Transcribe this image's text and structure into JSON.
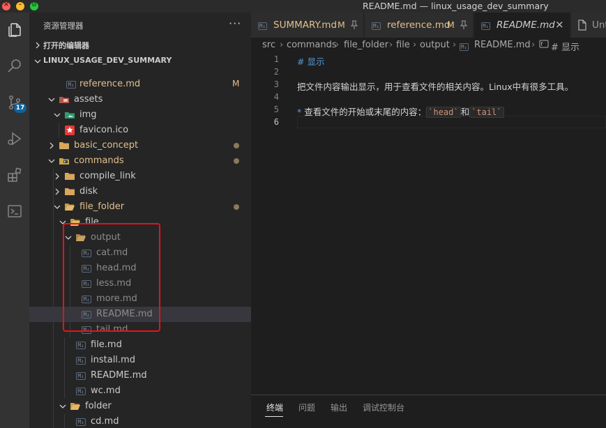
{
  "window": {
    "title": "README.md — linux_usage_dev_summary"
  },
  "activity": {
    "scm_badge": "17"
  },
  "sidebar": {
    "title": "资源管理器",
    "more": "···",
    "open_editors": "打开的编辑器",
    "workspace": "LINUX_USAGE_DEV_SUMMARY"
  },
  "tree": [
    {
      "name": "reference.md",
      "status": "M"
    },
    {
      "name": "assets"
    },
    {
      "name": "img"
    },
    {
      "name": "favicon.ico"
    },
    {
      "name": "basic_concept"
    },
    {
      "name": "commands"
    },
    {
      "name": "compile_link"
    },
    {
      "name": "disk"
    },
    {
      "name": "file_folder"
    },
    {
      "name": "file"
    },
    {
      "name": "output"
    },
    {
      "name": "cat.md"
    },
    {
      "name": "head.md"
    },
    {
      "name": "less.md"
    },
    {
      "name": "more.md"
    },
    {
      "name": "README.md"
    },
    {
      "name": "tail.md"
    },
    {
      "name": "file.md"
    },
    {
      "name": "install.md"
    },
    {
      "name": "README.md"
    },
    {
      "name": "wc.md"
    },
    {
      "name": "folder"
    },
    {
      "name": "cd.md"
    }
  ],
  "tabs": [
    {
      "label": "SUMMARY.md",
      "status": "M"
    },
    {
      "label": "reference.md",
      "status": "M"
    },
    {
      "label": "README.md",
      "close": "×"
    },
    {
      "label": "Unt"
    }
  ],
  "breadcrumb": [
    "src",
    "commands",
    "file_folder",
    "file",
    "output",
    "README.md",
    "# 显示"
  ],
  "editor": {
    "line_numbers": [
      "1",
      "2",
      "3",
      "4",
      "5",
      "6"
    ],
    "line1": "# 显示",
    "line3": "把文件内容输出显示，用于查看文件的相关内容。Linux中有很多工具。",
    "line5_bullet": "*",
    "line5_text": "查看文件的开始或末尾的内容：",
    "line5_code1": "head",
    "line5_mid": "和",
    "line5_code2": "tail",
    "backtick": "`"
  },
  "panel": {
    "tabs": [
      "终端",
      "问题",
      "输出",
      "调试控制台"
    ]
  }
}
